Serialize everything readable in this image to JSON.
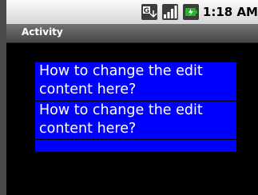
{
  "status_bar": {
    "time": "1:18",
    "ampm": "AM",
    "icons": [
      "gmail-notification-icon",
      "signal-strength-icon",
      "battery-charging-icon"
    ]
  },
  "title_bar": {
    "title": "Activity"
  },
  "edit_texts": [
    {
      "line1": "How to change the edit",
      "line2": "content here?"
    },
    {
      "line1": "How to change the edit",
      "line2": "content here?"
    }
  ],
  "colors": {
    "edit_background": "#0000ff",
    "edit_text": "#ffffff",
    "screen_background": "#000000"
  }
}
